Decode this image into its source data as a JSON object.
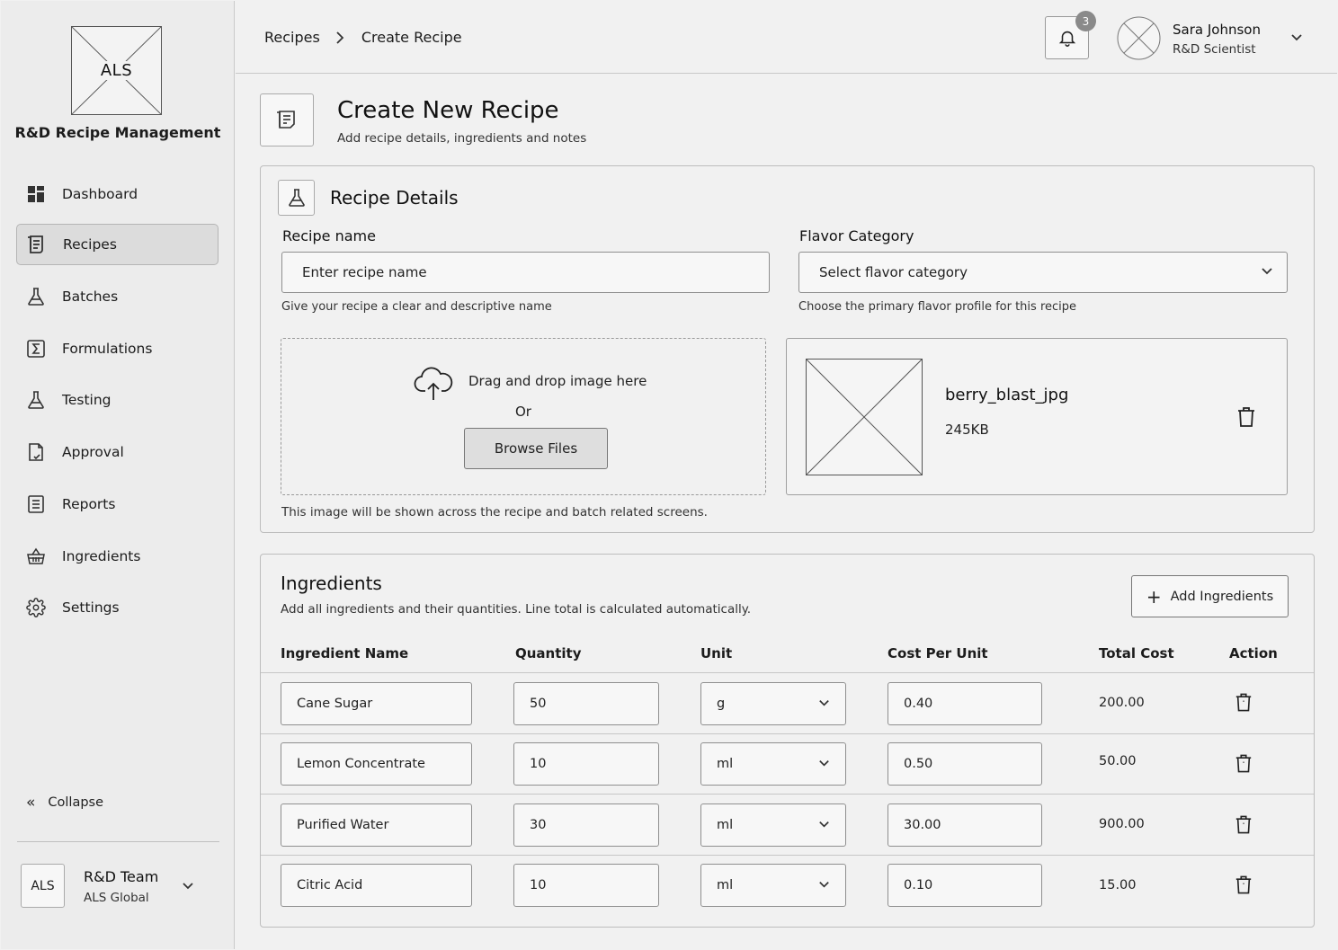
{
  "app": {
    "logo_text": "ALS",
    "name": "R&D Recipe Management"
  },
  "sidebar": {
    "items": [
      {
        "label": "Dashboard",
        "icon": "dashboard-icon"
      },
      {
        "label": "Recipes",
        "icon": "recipe-book-icon",
        "active": true
      },
      {
        "label": "Batches",
        "icon": "flask-icon"
      },
      {
        "label": "Formulations",
        "icon": "sigma-icon"
      },
      {
        "label": "Testing",
        "icon": "flask-icon"
      },
      {
        "label": "Approval",
        "icon": "document-check-icon"
      },
      {
        "label": "Reports",
        "icon": "report-icon"
      },
      {
        "label": "Ingredients",
        "icon": "basket-icon"
      },
      {
        "label": "Settings",
        "icon": "gear-icon"
      }
    ],
    "collapse_label": "Collapse",
    "team": {
      "avatar": "ALS",
      "name": "R&D Team",
      "org": "ALS Global"
    }
  },
  "header": {
    "breadcrumb": [
      "Recipes",
      "Create Recipe"
    ],
    "notifications": "3",
    "user": {
      "name": "Sara Johnson",
      "role": "R&D Scientist"
    }
  },
  "page": {
    "title": "Create New Recipe",
    "subtitle": "Add recipe details, ingredients and notes"
  },
  "details": {
    "title": "Recipe Details",
    "recipe_name": {
      "label": "Recipe name",
      "placeholder": "Enter recipe name",
      "helper": "Give your recipe a clear and descriptive name"
    },
    "flavor": {
      "label": "Flavor Category",
      "placeholder": "Select flavor category",
      "helper": "Choose the primary flavor profile for this recipe"
    },
    "upload": {
      "drag_text": "Drag and drop image here",
      "or_text": "Or",
      "browse_label": "Browse Files",
      "helper": "This image will be shown across the recipe and batch related screens."
    },
    "file": {
      "name": "berry_blast_jpg",
      "size": "245KB"
    }
  },
  "ingredients": {
    "title": "Ingredients",
    "subtitle": "Add all ingredients and their quantities. Line total is calculated automatically.",
    "add_label": "Add Ingredients",
    "columns": [
      "Ingredient Name",
      "Quantity",
      "Unit",
      "Cost Per Unit",
      "Total Cost",
      "Action"
    ],
    "rows": [
      {
        "name": "Cane Sugar",
        "quantity": "50",
        "unit": "g",
        "cost": "0.40",
        "total": "200.00"
      },
      {
        "name": "Lemon Concentrate",
        "quantity": "10",
        "unit": "ml",
        "cost": "0.50",
        "total": "50.00"
      },
      {
        "name": "Purified Water",
        "quantity": "30",
        "unit": "ml",
        "cost": "30.00",
        "total": "900.00"
      },
      {
        "name": "Citric Acid",
        "quantity": "10",
        "unit": "ml",
        "cost": "0.10",
        "total": "15.00"
      }
    ]
  }
}
